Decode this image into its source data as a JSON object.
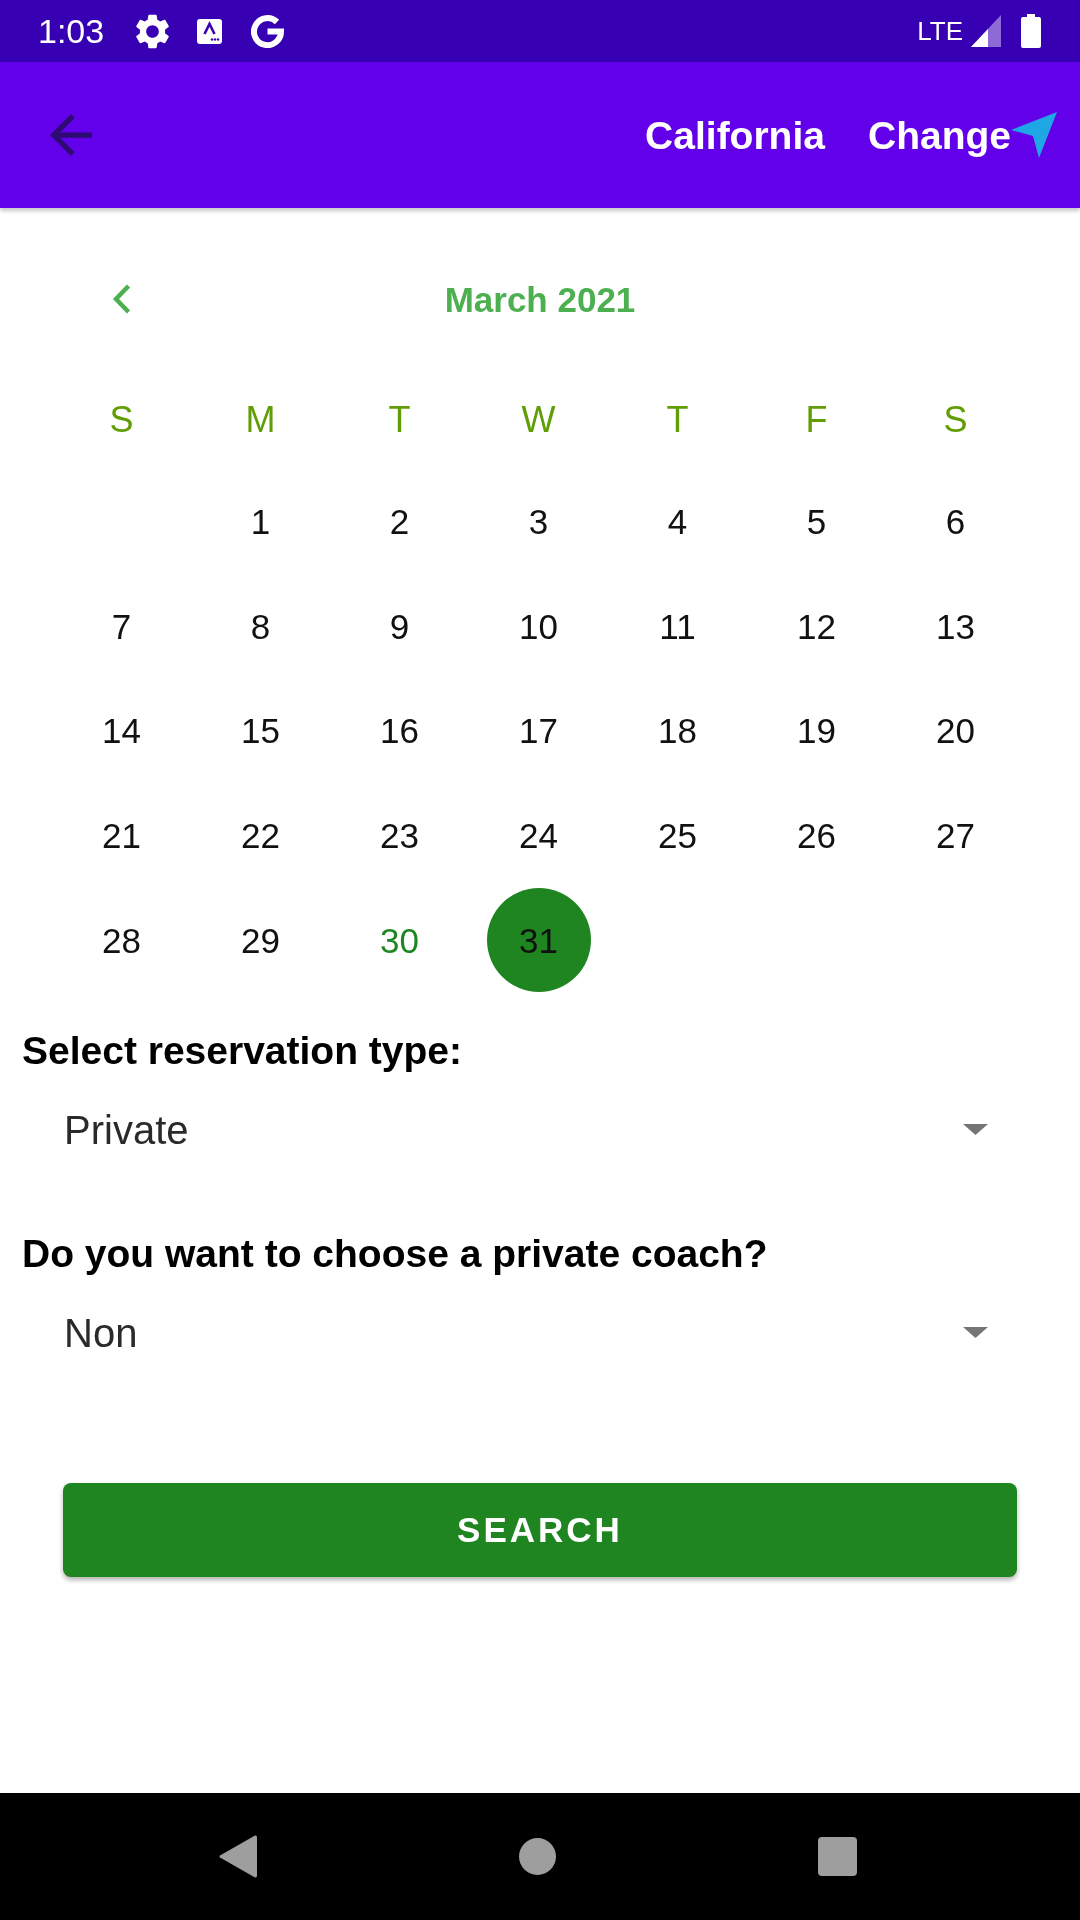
{
  "status_bar": {
    "time": "1:03",
    "network": "LTE"
  },
  "app_bar": {
    "location": "California",
    "action": "Change"
  },
  "calendar": {
    "month": "March 2021",
    "weekdays": [
      "S",
      "M",
      "T",
      "W",
      "T",
      "F",
      "S"
    ],
    "weeks": [
      {
        "days": [
          {
            "label": "1",
            "selected": false,
            "today": false
          },
          {
            "label": "2",
            "selected": false,
            "today": false
          },
          {
            "label": "3",
            "selected": false,
            "today": false
          },
          {
            "label": "4",
            "selected": false,
            "today": false
          },
          {
            "label": "5",
            "selected": false,
            "today": false
          },
          {
            "label": "6",
            "selected": false,
            "today": false
          }
        ]
      },
      {
        "days": [
          {
            "label": "7",
            "selected": false,
            "today": false
          },
          {
            "label": "8",
            "selected": false,
            "today": false
          },
          {
            "label": "9",
            "selected": false,
            "today": false
          },
          {
            "label": "10",
            "selected": false,
            "today": false
          },
          {
            "label": "11",
            "selected": false,
            "today": false
          },
          {
            "label": "12",
            "selected": false,
            "today": false
          },
          {
            "label": "13",
            "selected": false,
            "today": false
          }
        ]
      },
      {
        "days": [
          {
            "label": "14",
            "selected": false,
            "today": false
          },
          {
            "label": "15",
            "selected": false,
            "today": false
          },
          {
            "label": "16",
            "selected": false,
            "today": false
          },
          {
            "label": "17",
            "selected": false,
            "today": false
          },
          {
            "label": "18",
            "selected": false,
            "today": false
          },
          {
            "label": "19",
            "selected": false,
            "today": false
          },
          {
            "label": "20",
            "selected": false,
            "today": false
          }
        ]
      },
      {
        "days": [
          {
            "label": "21",
            "selected": false,
            "today": false
          },
          {
            "label": "22",
            "selected": false,
            "today": false
          },
          {
            "label": "23",
            "selected": false,
            "today": false
          },
          {
            "label": "24",
            "selected": false,
            "today": false
          },
          {
            "label": "25",
            "selected": false,
            "today": false
          },
          {
            "label": "26",
            "selected": false,
            "today": false
          },
          {
            "label": "27",
            "selected": false,
            "today": false
          }
        ]
      },
      {
        "days": [
          {
            "label": "28",
            "selected": false,
            "today": false
          },
          {
            "label": "29",
            "selected": false,
            "today": false
          },
          {
            "label": "30",
            "selected": false,
            "today": true
          },
          {
            "label": "31",
            "selected": true,
            "today": false
          }
        ]
      }
    ]
  },
  "form": {
    "fields": [
      {
        "label": "Select reservation type:",
        "value": "Private"
      },
      {
        "label": "Do you want to choose a private coach?",
        "value": "Non"
      }
    ]
  },
  "search_button": {
    "label": "SEARCH"
  }
}
